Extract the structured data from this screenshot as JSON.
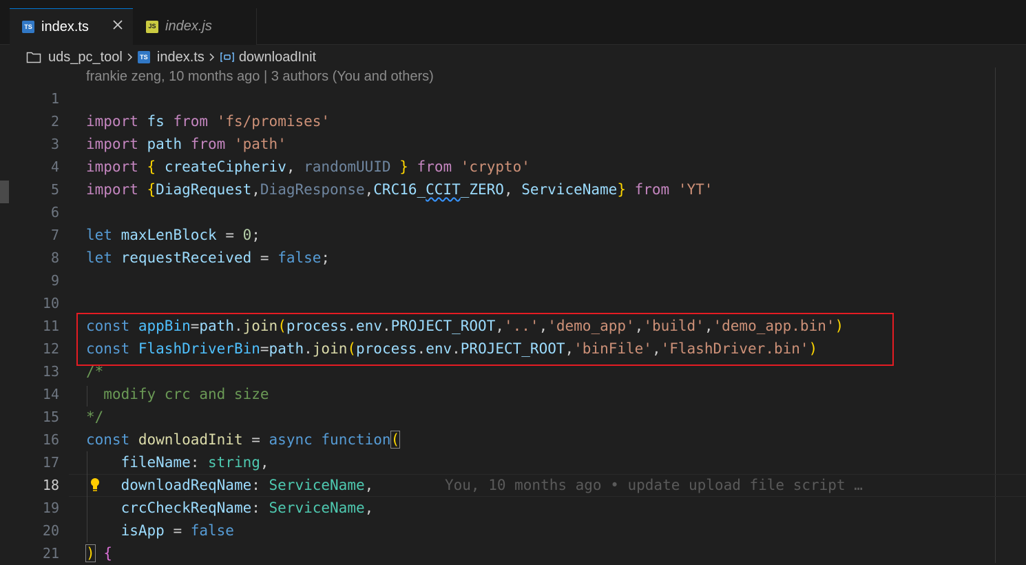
{
  "tabs": [
    {
      "icon": "ts-file-icon",
      "badge": "TS",
      "label": "index.ts",
      "active": true
    },
    {
      "icon": "js-file-icon",
      "badge": "JS",
      "label": "index.js",
      "active": false
    }
  ],
  "breadcrumb": {
    "folder": "uds_pc_tool",
    "file_badge": "TS",
    "file": "index.ts",
    "symbol": "downloadInit"
  },
  "codelens": "frankie zeng, 10 months ago | 3 authors (You and others)",
  "inline_blame": "You, 10 months ago • update upload file script …",
  "current_line": 18,
  "lines": [
    {
      "n": "1",
      "code": ""
    },
    {
      "n": "2",
      "code": "import fs from 'fs/promises'"
    },
    {
      "n": "3",
      "code": "import path from 'path'"
    },
    {
      "n": "4",
      "code": "import { createCipheriv, randomUUID } from 'crypto'"
    },
    {
      "n": "5",
      "code": "import {DiagRequest,DiagResponse,CRC16_CCIT_ZERO, ServiceName} from 'YT'"
    },
    {
      "n": "6",
      "code": ""
    },
    {
      "n": "7",
      "code": "let maxLenBlock = 0;"
    },
    {
      "n": "8",
      "code": "let requestReceived = false;"
    },
    {
      "n": "9",
      "code": ""
    },
    {
      "n": "10",
      "code": ""
    },
    {
      "n": "11",
      "code": "const appBin=path.join(process.env.PROJECT_ROOT,'..','demo_app','build','demo_app.bin')"
    },
    {
      "n": "12",
      "code": "const FlashDriverBin=path.join(process.env.PROJECT_ROOT,'binFile','FlashDriver.bin')"
    },
    {
      "n": "13",
      "code": "/*"
    },
    {
      "n": "14",
      "code": "  modify crc and size"
    },
    {
      "n": "15",
      "code": "*/"
    },
    {
      "n": "16",
      "code": "const downloadInit = async function("
    },
    {
      "n": "17",
      "code": "  fileName: string,"
    },
    {
      "n": "18",
      "code": "  downloadReqName: ServiceName,"
    },
    {
      "n": "19",
      "code": "  crcCheckReqName: ServiceName,"
    },
    {
      "n": "20",
      "code": "  isApp = false"
    },
    {
      "n": "21",
      "code": ") {"
    }
  ]
}
